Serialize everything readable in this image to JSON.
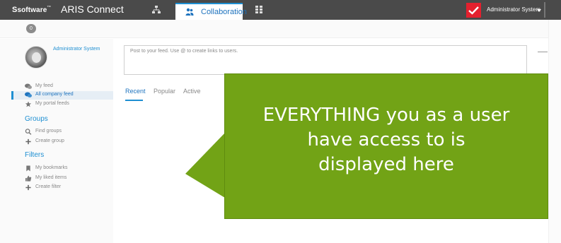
{
  "header": {
    "brand": "software",
    "app_title": "ARIS Connect",
    "active_tab": "Collaboration",
    "user_name": "Administrator System"
  },
  "subbar": {
    "count": "0"
  },
  "profile": {
    "name": "Administrator System"
  },
  "sidebar": {
    "feeds": [
      {
        "label": "My feed",
        "icon": "comments-icon"
      },
      {
        "label": "All company feed",
        "icon": "comments-icon"
      },
      {
        "label": "My portal feeds",
        "icon": "star-icon"
      }
    ],
    "groups_heading": "Groups",
    "groups": [
      {
        "label": "Find groups",
        "icon": "search-icon"
      },
      {
        "label": "Create group",
        "icon": "plus-icon"
      }
    ],
    "filters_heading": "Filters",
    "filters": [
      {
        "label": "My bookmarks",
        "icon": "bookmark-icon"
      },
      {
        "label": "My liked items",
        "icon": "thumbs-up-icon"
      },
      {
        "label": "Create filter",
        "icon": "plus-icon"
      }
    ]
  },
  "post": {
    "placeholder": "Post to your feed. Use @ to create links to users."
  },
  "feed_tabs": [
    "Recent",
    "Popular",
    "Active"
  ],
  "callout": {
    "lines": [
      "EVERYTHING you as a user",
      "have access to is",
      "displayed here"
    ]
  },
  "colors": {
    "accent": "#1e8fd2",
    "callout_bg": "#72a316",
    "topbar_bg": "#4a4a4a",
    "notify": "#e4202e"
  }
}
